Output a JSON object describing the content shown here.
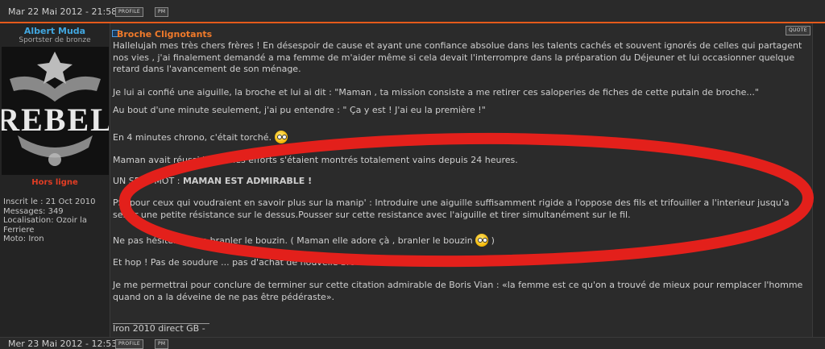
{
  "post_top": {
    "date": "Mar 22 Mai 2012 - 21:58",
    "buttons": [
      "PROFILE",
      "PM"
    ],
    "quote": "QUOTE"
  },
  "user": {
    "name": "Albert Muda",
    "rank": "Sportster de bronze",
    "avatar_text": "REBEL",
    "status": "Hors ligne",
    "info": [
      "Inscrit le : 21 Oct 2010",
      "Messages: 349",
      "Localisation: Ozoir la Ferriere",
      "Moto: Iron"
    ]
  },
  "post": {
    "title": "Broche Clignotants",
    "paragraphs": [
      "Hallelujah mes très chers frères ! En désespoir de cause et ayant une confiance absolue dans les talents cachés et souvent ignorés de celles qui partagent nos vies , j'ai finalement demandé a ma femme de m'aider même si cela devait l'interrompre dans la préparation du Déjeuner et lui occasionner quelque retard dans l'avancement de son ménage.",
      "Je lui ai confié une aiguille, la broche et lui ai dit : \"Maman , ta mission consiste a me retirer ces saloperies de fiches de cette putain de broche...\"",
      "Au bout d'une minute seulement, j'ai pu entendre : \" Ça y est ! J'ai eu la première !\"",
      "En 4 minutes chrono, c'était torché.",
      "Maman avait réussi la ou mes efforts s'étaient montrés totalement vains depuis 24 heures.",
      "UN SEUL MOT :",
      "MAMAN EST ADMIRABLE !",
      "PS :pour ceux qui voudraient en savoir plus sur la manip' : Introduire une aiguille suffisamment rigide a l'oppose des fils et trifouiller a l'interieur jusqu'a sentir une petite résistance sur le dessus.Pousser sur cette resistance avec l'aiguille et tirer simultanément sur le fil.",
      "Ne pas hésiter a bien branler le bouzin. ( Maman elle adore çà , branler le bouzin",
      ")",
      "Et hop ! Pas de soudure ... pas d'achat de nouvelle broche ...",
      "Je me permettrai pour conclure de terminer sur cette citation admirable de Boris Vian : «la femme est ce qu'on a trouvé de mieux pour remplacer l'homme quand on a la déveine de ne pas être pédéraste»."
    ],
    "signature": "Iron 2010 direct GB -"
  },
  "post_bottom": {
    "date": "Mer 23 Mai 2012 - 12:53",
    "buttons": [
      "PROFILE",
      "PM"
    ]
  },
  "colors": {
    "accent": "#e45a1b",
    "username": "#41a7e0",
    "offline": "#e23d24",
    "title": "#f07a2a",
    "annotation": "#e3201b"
  },
  "icons": [
    "topic-icon",
    "laugh-emoji-icon",
    "wink-emoji-icon"
  ]
}
